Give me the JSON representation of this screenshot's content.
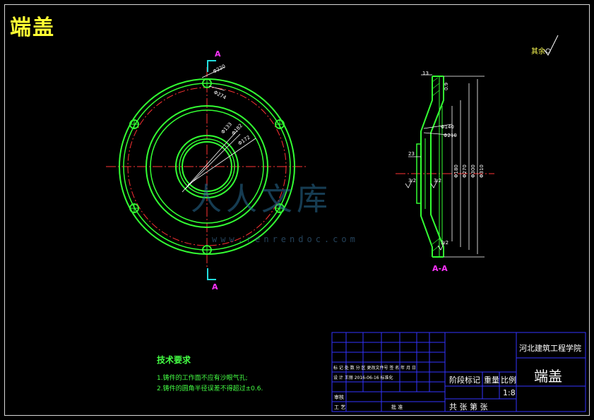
{
  "drawing": {
    "title": "端盖",
    "roughness_label": "其余",
    "section_label_top": "A",
    "section_label_bottom": "A",
    "section_view_label": "A-A",
    "watermark": "人人文库",
    "watermark_url": "www.renrendoc.com"
  },
  "dims_front": [
    "Φ220",
    "Φ274",
    "Φ133",
    "Φ182",
    "Φ172"
  ],
  "dims_section": [
    "13",
    "0.9",
    "Φ140",
    "Φ210",
    "23",
    "3.2",
    "3.2",
    "Φ180",
    "Φ270",
    "Φ300",
    "Φ310",
    "3.2"
  ],
  "tech_requirements": {
    "title": "技术要求",
    "items": [
      "1.铸件的工作面不应有沙眼气孔;",
      "2.铸件的圆角半径误差不得超过±0.6."
    ]
  },
  "title_block": {
    "school": "河北建筑工程学院",
    "part_name": "端盖",
    "header_row": "标 记  处 数   分  区   更改文件号   签 名   年 月 日",
    "design_row": "设 计   王丽     2016-06-16  标准化",
    "review": "审核",
    "process": "工 艺",
    "approve": "批 准",
    "stage_mark": "阶段标记",
    "weight": "重量",
    "scale_label": "比例",
    "scale_value": "1:8",
    "sheets": "共  张  第  张"
  },
  "colors": {
    "outline": "#33ff33",
    "center_line": "#ff3333",
    "dimension": "#ffffff",
    "section_mark": "#22dddd",
    "label": "#ffff33"
  }
}
